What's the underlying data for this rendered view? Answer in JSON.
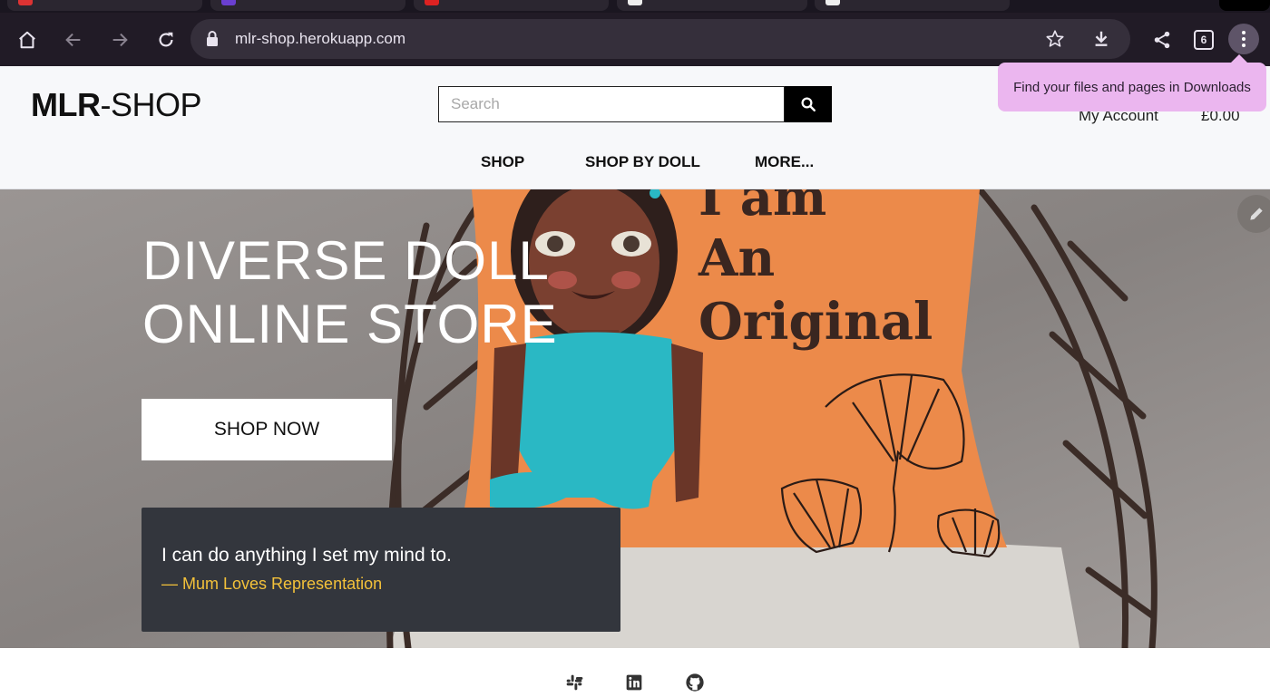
{
  "browser": {
    "url": "mlr-shop.herokuapp.com",
    "tab_count": "6",
    "tooltip": "Find your files and pages in Downloads"
  },
  "site": {
    "logo_bold": "MLR",
    "logo_rest": "-SHOP",
    "search_placeholder": "Search",
    "account_label": "My Account",
    "cart_total": "£0.00",
    "nav": [
      "SHOP",
      "SHOP BY DOLL",
      "MORE..."
    ]
  },
  "hero": {
    "title_line1": "DIVERSE DOLL",
    "title_line2": "ONLINE STORE",
    "cta_label": "SHOP NOW",
    "pillow_text": [
      "I am",
      "An",
      "Original"
    ],
    "quote": "I can do anything I set my mind to.",
    "quote_author": "— Mum Loves Representation"
  },
  "footer": {
    "icons": [
      "slack-icon",
      "linkedin-icon",
      "github-icon"
    ]
  },
  "colors": {
    "browser_bg": "#211b26",
    "tooltip_bg": "#ebb6ef",
    "quote_box_bg": "#33363d",
    "quote_author": "#f3c13a",
    "pillow": "#ec8a4a",
    "dress": "#2ab8c4"
  }
}
